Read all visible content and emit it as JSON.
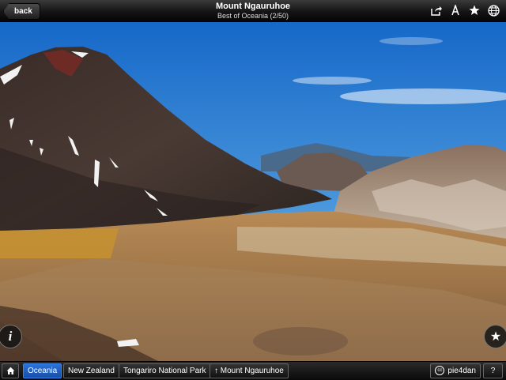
{
  "header": {
    "back_label": "back",
    "title": "Mount Ngauruhoe",
    "subtitle": "Best of Oceania (2/50)",
    "icons": [
      "share-icon",
      "text-size-icon",
      "star-icon",
      "globe-icon"
    ]
  },
  "photo": {
    "description_icon": "info-icon"
  },
  "floating": {
    "info_label": "i",
    "fav_label": "★"
  },
  "breadcrumb": {
    "home_icon": "home-icon",
    "items": [
      "Oceania",
      "New Zealand",
      "Tongariro National Park",
      "Mount Ngauruhoe"
    ],
    "pin_glyph": "↑"
  },
  "footer": {
    "author_label": "pie4dan",
    "cc_label": "cc",
    "help_label": "?"
  },
  "colors": {
    "active_crumb": "#2b72d8",
    "sky_top": "#1a6fd0",
    "sky_bottom": "#b8d8ef"
  }
}
